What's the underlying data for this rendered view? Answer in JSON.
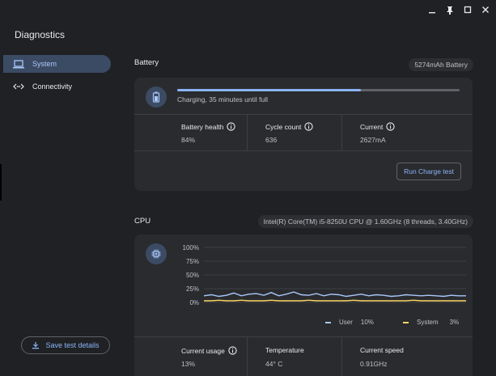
{
  "app": {
    "title": "Diagnostics"
  },
  "nav": {
    "items": [
      {
        "label": "System",
        "icon": "laptop-icon"
      },
      {
        "label": "Connectivity",
        "icon": "connectivity-icon"
      }
    ],
    "save_label": "Save test details"
  },
  "battery": {
    "title": "Battery",
    "capacity": "5274mAh Battery",
    "charge_level": 0.65,
    "status": "Charging, 35 minutes until full",
    "health_label": "Battery health",
    "health_value": "84%",
    "cycle_label": "Cycle count",
    "cycle_value": "636",
    "current_label": "Current",
    "current_value": "2627mA",
    "run_label": "Run Charge test"
  },
  "cpu": {
    "title": "CPU",
    "model": "Intel(R) Core(TM) i5-8250U CPU @ 1.60GHz (8 threads, 3.40GHz)",
    "y_ticks": [
      "100%",
      "75%",
      "50%",
      "25%",
      "0%"
    ],
    "user_label": "User",
    "user_value": "10%",
    "system_label": "System",
    "system_value": "3%",
    "usage_label": "Current usage",
    "usage_value": "13%",
    "temp_label": "Temperature",
    "temp_value": "44° C",
    "speed_label": "Current speed",
    "speed_value": "0.91GHz"
  },
  "chart_data": {
    "type": "line",
    "ylim": [
      0,
      100
    ],
    "series": [
      {
        "name": "User",
        "color": "#a8c7fa",
        "values": [
          12,
          14,
          11,
          13,
          17,
          12,
          15,
          16,
          13,
          18,
          12,
          15,
          19,
          14,
          13,
          16,
          12,
          15,
          14,
          11,
          13,
          15,
          12,
          14,
          13,
          11,
          12,
          14,
          13,
          12,
          13,
          12,
          11,
          13,
          12,
          12
        ]
      },
      {
        "name": "System",
        "color": "#fdd663",
        "values": [
          3,
          3,
          4,
          3,
          3,
          4,
          3,
          3,
          3,
          4,
          3,
          3,
          3,
          3,
          4,
          3,
          3,
          3,
          3,
          3,
          4,
          3,
          3,
          3,
          3,
          3,
          3,
          3,
          4,
          3,
          3,
          3,
          3,
          3,
          3,
          3
        ]
      }
    ]
  }
}
